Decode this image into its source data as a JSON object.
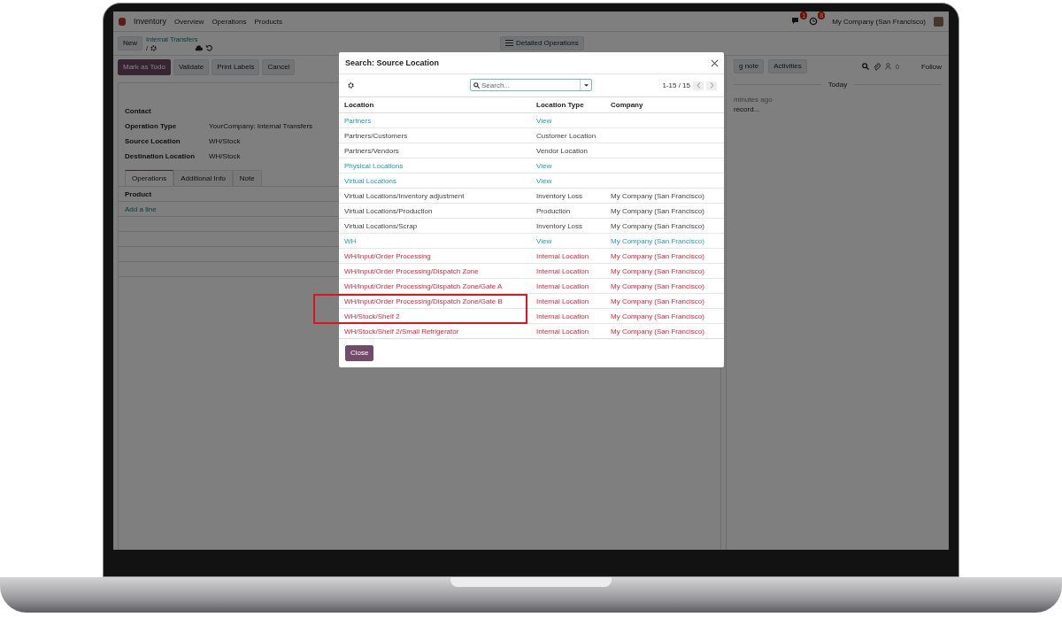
{
  "navbar": {
    "app": "Inventory",
    "menu": [
      "Overview",
      "Operations",
      "Products"
    ],
    "message_badge": "1",
    "activity_badge": "8",
    "company": "My Company (San Francisco)"
  },
  "control_panel": {
    "new_button": "New",
    "breadcrumb": "Internal Transfers",
    "separator": "/",
    "detailed_button": "Detailed Operations"
  },
  "actions": [
    {
      "label": "Mark as Todo",
      "primary": true
    },
    {
      "label": "Validate",
      "primary": false
    },
    {
      "label": "Print Labels",
      "primary": false
    },
    {
      "label": "Cancel",
      "primary": false
    }
  ],
  "form": {
    "fields": [
      {
        "label": "Contact"
      },
      {
        "label": "Operation Type",
        "value": "YourCompany: Internal Transfers"
      },
      {
        "label": "Source Location",
        "value": "WH/Stock"
      },
      {
        "label": "Destination Location",
        "value": "WH/Stock"
      }
    ],
    "tabs": [
      {
        "label": "Operations",
        "selected": true
      },
      {
        "label": "Additional Info",
        "selected": false
      },
      {
        "label": "Note",
        "selected": false
      }
    ],
    "column": "Product",
    "add_line": "Add a line"
  },
  "chatter": {
    "log_note": "g note",
    "activities": "Activities",
    "followers": "0",
    "follow": "Follow",
    "date": "Today",
    "time": "minutes ago",
    "message": "record..."
  },
  "dialog": {
    "title": "Search: Source Location",
    "search": {
      "placeholder": "Search..."
    },
    "pager": "1-15 / 15",
    "columns": [
      "Location",
      "Location Type",
      "Company"
    ],
    "rows": [
      {
        "kind": "view",
        "location": "Partners",
        "type": "View",
        "company": "",
        "highlighted": false
      },
      {
        "kind": "plain",
        "location": "Partners/Customers",
        "type": "Customer Location",
        "company": "",
        "highlighted": false
      },
      {
        "kind": "plain",
        "location": "Partners/Vendors",
        "type": "Vendor Location",
        "company": "",
        "highlighted": false
      },
      {
        "kind": "view",
        "location": "Physical Locations",
        "type": "View",
        "company": "",
        "highlighted": false
      },
      {
        "kind": "view",
        "location": "Virtual Locations",
        "type": "View",
        "company": "",
        "highlighted": false
      },
      {
        "kind": "plain",
        "location": "Virtual Locations/Inventory adjustment",
        "type": "Inventory Loss",
        "company": "My Company (San Francisco)",
        "highlighted": false
      },
      {
        "kind": "plain",
        "location": "Virtual Locations/Production",
        "type": "Production",
        "company": "My Company (San Francisco)",
        "highlighted": false
      },
      {
        "kind": "plain",
        "location": "Virtual Locations/Scrap",
        "type": "Inventory Loss",
        "company": "My Company (San Francisco)",
        "highlighted": false
      },
      {
        "kind": "view",
        "location": "WH",
        "type": "View",
        "company": "My Company (San Francisco)",
        "highlighted": false
      },
      {
        "kind": "internal",
        "location": "WH/Input/Order Processing",
        "type": "Internal Location",
        "company": "My Company (San Francisco)",
        "highlighted": false
      },
      {
        "kind": "internal",
        "location": "WH/Input/Order Processing/Dispatch Zone",
        "type": "Internal Location",
        "company": "My Company (San Francisco)",
        "highlighted": false
      },
      {
        "kind": "internal",
        "location": "WH/Input/Order Processing/Dispatch Zone/Gate A",
        "type": "Internal Location",
        "company": "My Company (San Francisco)",
        "highlighted": false
      },
      {
        "kind": "internal",
        "location": "WH/Input/Order Processing/Dispatch Zone/Gate B",
        "type": "Internal Location",
        "company": "My Company (San Francisco)",
        "highlighted": true
      },
      {
        "kind": "internal",
        "location": "WH/Stock/Shelf 2",
        "type": "Internal Location",
        "company": "My Company (San Francisco)",
        "highlighted": true
      },
      {
        "kind": "internal",
        "location": "WH/Stock/Shelf 2/Small Refrigerator",
        "type": "Internal Location",
        "company": "My Company (San Francisco)",
        "highlighted": false
      }
    ],
    "close_button": "Close"
  }
}
